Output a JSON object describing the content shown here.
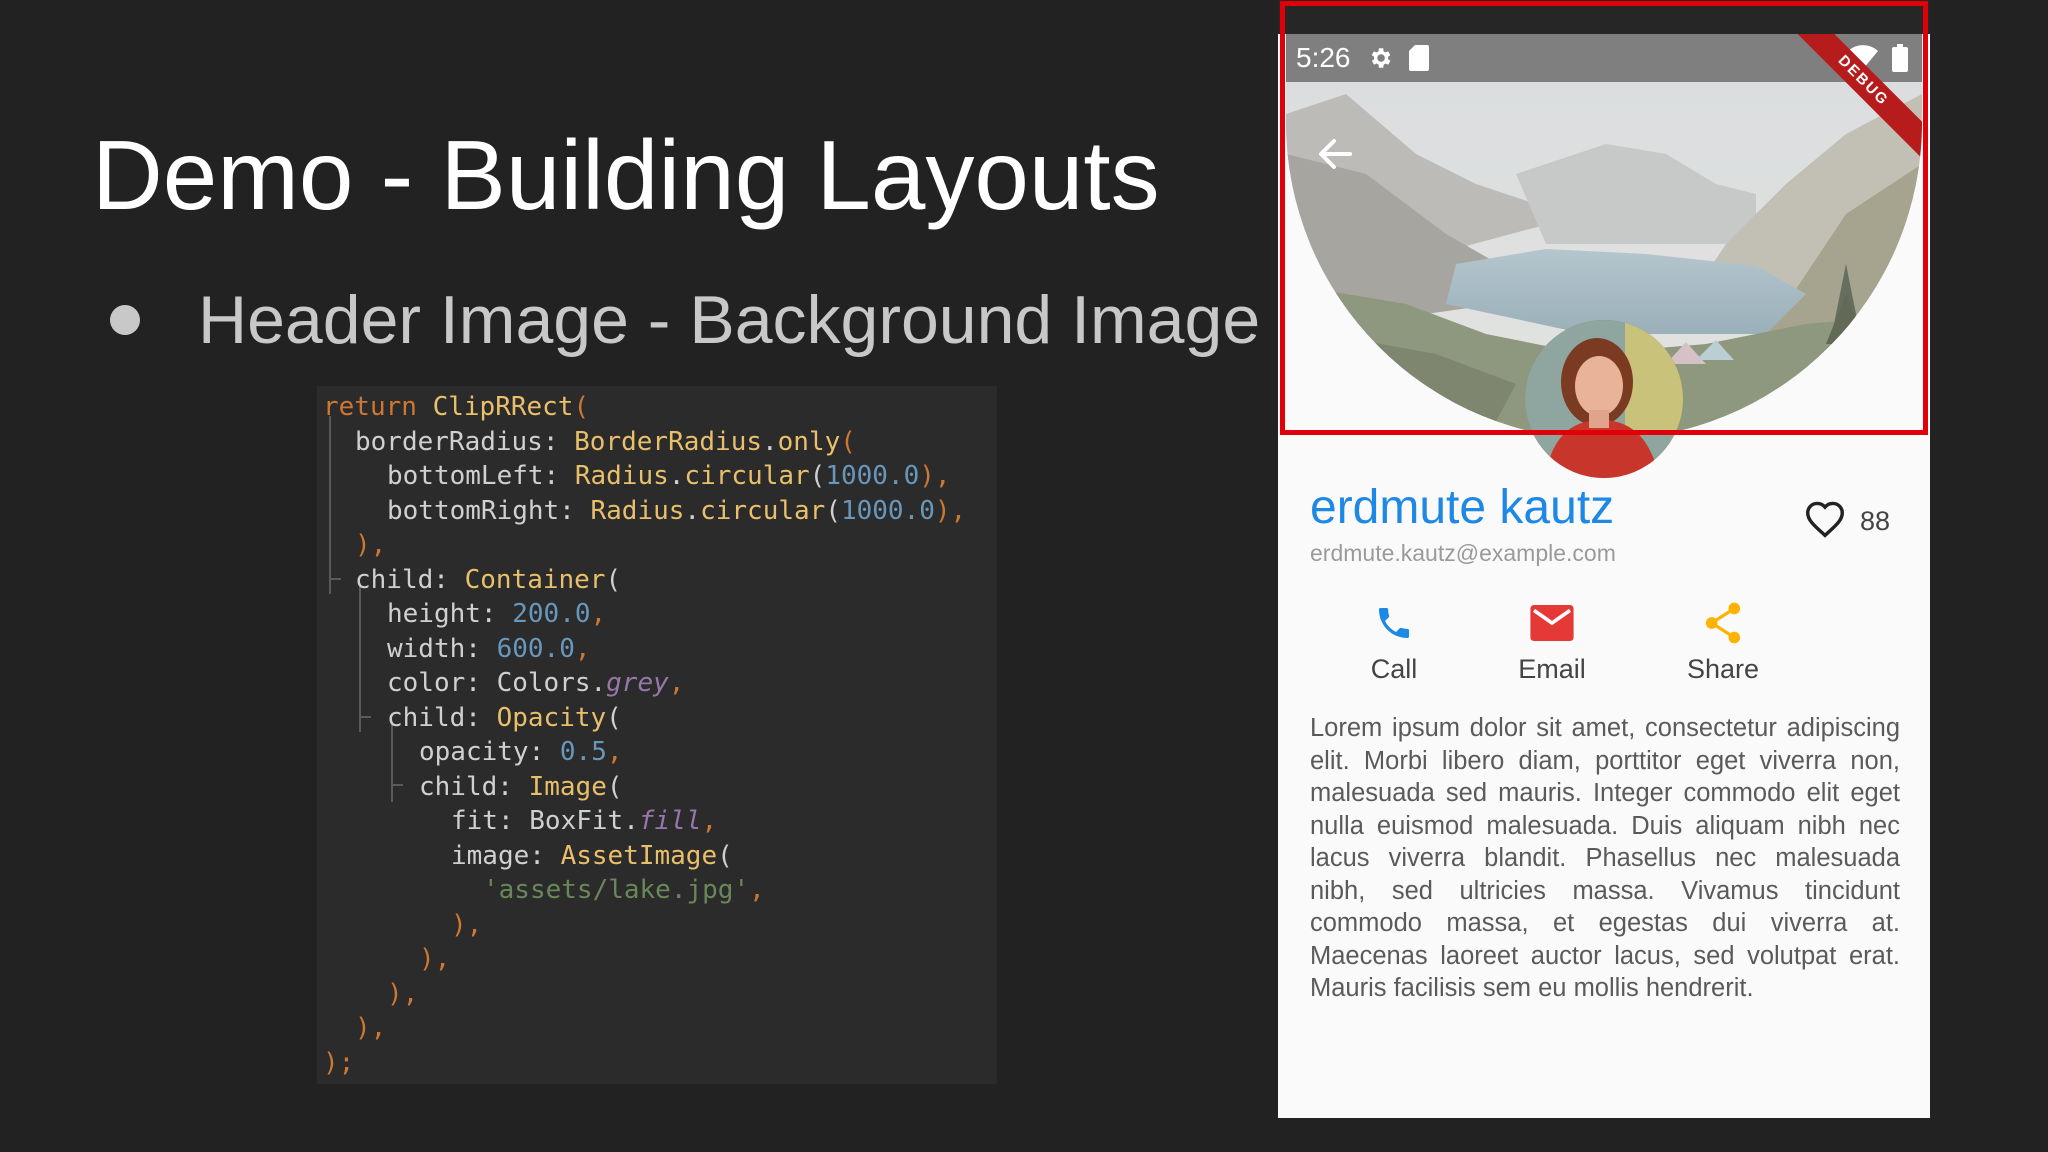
{
  "slide": {
    "title": "Demo - Building Layouts",
    "bullet": "Header Image - Background Image"
  },
  "code": {
    "lines": [
      [
        [
          "return ",
          "kw"
        ],
        [
          "ClipRRect",
          "cls"
        ],
        [
          "(",
          "pun"
        ]
      ],
      [
        [
          "borderRadius: ",
          ""
        ],
        [
          "BorderRadius",
          "cls"
        ],
        [
          ".",
          ""
        ],
        [
          "only",
          "cls"
        ],
        [
          "(",
          "pun"
        ]
      ],
      [
        [
          "bottomLeft: ",
          ""
        ],
        [
          "Radius",
          "cls"
        ],
        [
          ".",
          ""
        ],
        [
          "circular",
          "cls"
        ],
        [
          "(",
          ""
        ],
        [
          "1000.0",
          "num"
        ],
        [
          "),",
          "pun"
        ]
      ],
      [
        [
          "bottomRight: ",
          ""
        ],
        [
          "Radius",
          "cls"
        ],
        [
          ".",
          ""
        ],
        [
          "circular",
          "cls"
        ],
        [
          "(",
          ""
        ],
        [
          "1000.0",
          "num"
        ],
        [
          "),",
          "pun"
        ]
      ],
      [
        [
          "),",
          "pun"
        ]
      ],
      [
        [
          "child: ",
          ""
        ],
        [
          "Container",
          "cls"
        ],
        [
          "(",
          ""
        ]
      ],
      [
        [
          "height: ",
          ""
        ],
        [
          "200.0",
          "num"
        ],
        [
          ",",
          "pun"
        ]
      ],
      [
        [
          "width: ",
          ""
        ],
        [
          "600.0",
          "num"
        ],
        [
          ",",
          "pun"
        ]
      ],
      [
        [
          "color: ",
          ""
        ],
        [
          "Colors",
          ""
        ],
        [
          ".",
          ""
        ],
        [
          "grey",
          "ital"
        ],
        [
          ",",
          "pun"
        ]
      ],
      [
        [
          "child: ",
          ""
        ],
        [
          "Opacity",
          "cls"
        ],
        [
          "(",
          ""
        ]
      ],
      [
        [
          "opacity: ",
          ""
        ],
        [
          "0.5",
          "num"
        ],
        [
          ",",
          "pun"
        ]
      ],
      [
        [
          "child: ",
          ""
        ],
        [
          "Image",
          "cls"
        ],
        [
          "(",
          ""
        ]
      ],
      [
        [
          "fit: ",
          ""
        ],
        [
          "BoxFit",
          ""
        ],
        [
          ".",
          ""
        ],
        [
          "fill",
          "ital"
        ],
        [
          ",",
          "pun"
        ]
      ],
      [
        [
          "image: ",
          ""
        ],
        [
          "AssetImage",
          "cls"
        ],
        [
          "(",
          ""
        ]
      ],
      [
        [
          "'assets/lake.jpg'",
          "str"
        ],
        [
          ",",
          "pun"
        ]
      ],
      [
        [
          "),",
          "pun"
        ]
      ],
      [
        [
          "),",
          "pun"
        ]
      ],
      [
        [
          "),",
          "pun"
        ]
      ],
      [
        [
          "),",
          "pun"
        ]
      ],
      [
        [
          ");",
          "pun"
        ]
      ]
    ]
  },
  "phone": {
    "status_time": "5:26",
    "debug_label": "DEBUG",
    "profile": {
      "name": "erdmute kautz",
      "email": "erdmute.kautz@example.com",
      "favorite_count": "88"
    },
    "actions": [
      {
        "label": "Call",
        "icon": "phone-icon",
        "color": "#1e88e5"
      },
      {
        "label": "Email",
        "icon": "email-icon",
        "color": "#e53935"
      },
      {
        "label": "Share",
        "icon": "share-icon",
        "color": "#ffb300"
      }
    ],
    "description": "Lorem ipsum dolor sit amet, consectetur adipiscing elit. Morbi libero diam, porttitor eget viverra non, malesuada sed mauris. Integer commodo elit eget nulla euismod malesuada. Duis aliquam nibh nec lacus viverra blandit. Phasellus nec malesuada nibh, sed ultricies massa. Vivamus tincidunt commodo massa, et egestas dui viverra at. Maecenas laoreet auctor lacus, sed volutpat erat. Mauris facilisis sem eu mollis hendrerit."
  },
  "colors": {
    "slide_bg": "#222222",
    "highlight_box": "#e0000a",
    "name_blue": "#1e88e5"
  }
}
